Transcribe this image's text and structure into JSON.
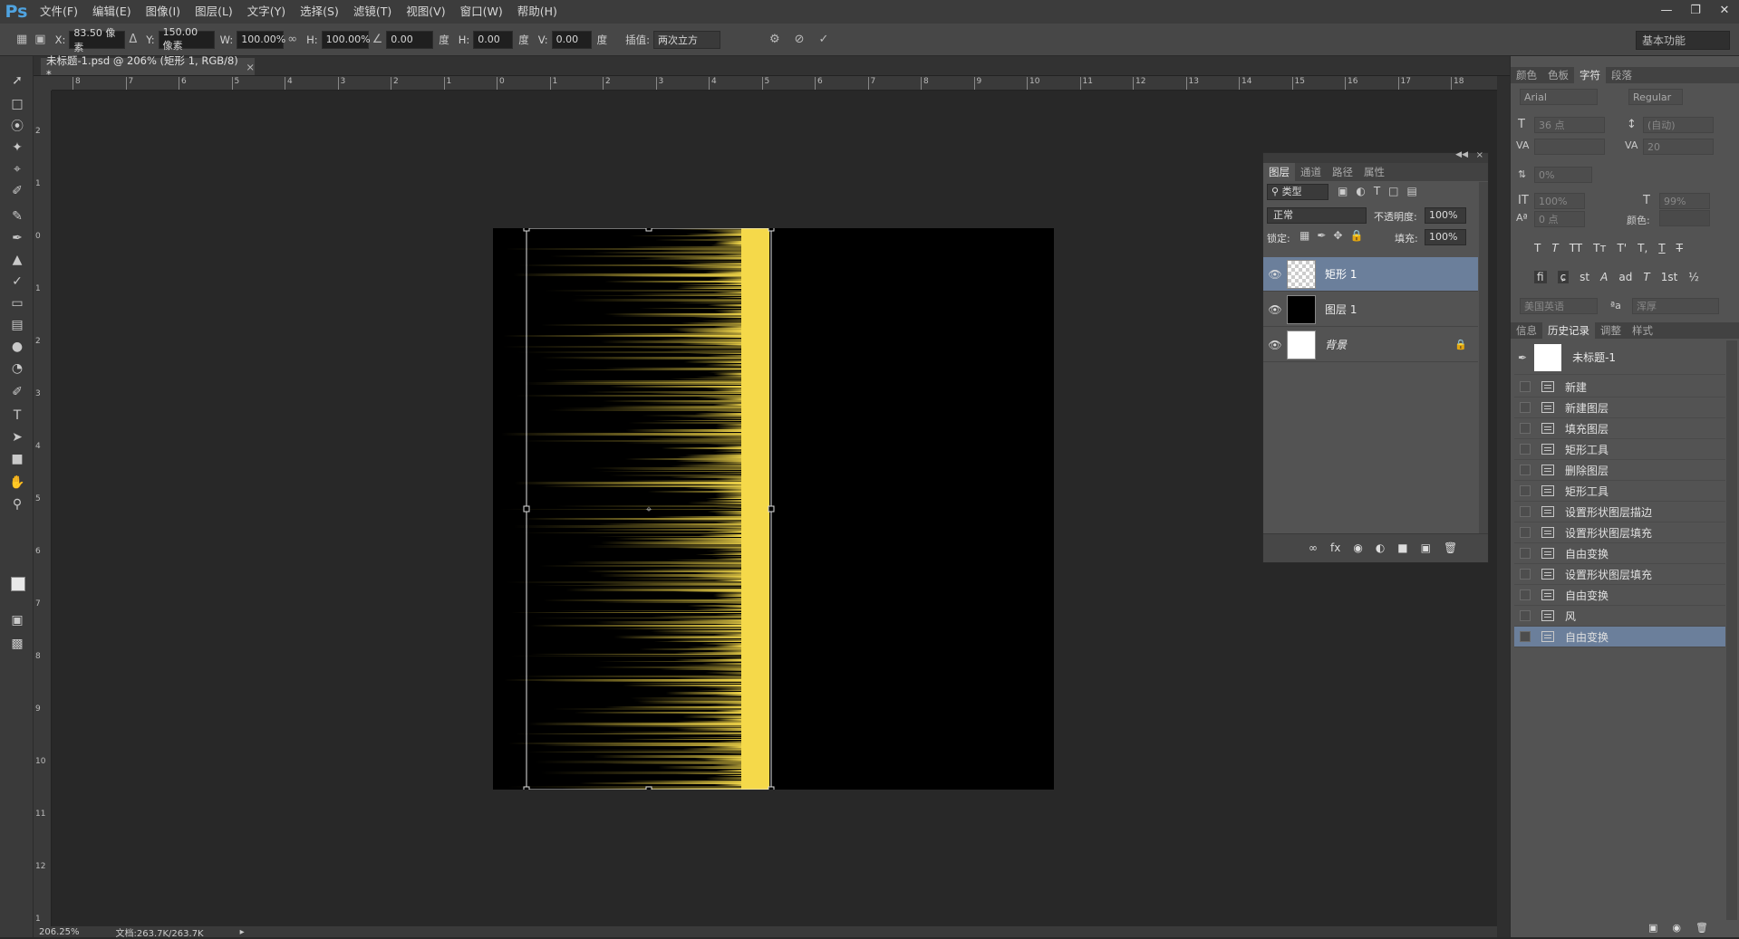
{
  "menubar": {
    "logo": "Ps",
    "items": [
      "文件(F)",
      "编辑(E)",
      "图像(I)",
      "图层(L)",
      "文字(Y)",
      "选择(S)",
      "滤镜(T)",
      "视图(V)",
      "窗口(W)",
      "帮助(H)"
    ]
  },
  "options": {
    "x_label": "X:",
    "x_value": "83.50 像素",
    "y_label": "Y:",
    "y_value": "150.00 像素",
    "w_label": "W:",
    "w_value": "100.00%",
    "h_label": "H:",
    "h_value": "100.00%",
    "angle_value": "0.00",
    "deg": "度",
    "hskew_label": "H:",
    "hskew_value": "0.00",
    "vskew_label": "V:",
    "vskew_value": "0.00",
    "interp_label": "插值:",
    "interp_value": "两次立方",
    "workspace": "基本功能"
  },
  "document": {
    "tab_title": "未标题-1.psd @ 206% (矩形 1, RGB/8) *",
    "zoom": "206.25%",
    "doc_size": "文档:263.7K/263.7K"
  },
  "ruler_top": [
    "8",
    "7",
    "6",
    "5",
    "4",
    "3",
    "2",
    "1",
    "0",
    "1",
    "2",
    "3",
    "4",
    "5",
    "6",
    "7",
    "8",
    "9",
    "10",
    "11",
    "12",
    "13",
    "14",
    "15",
    "16",
    "17",
    "18"
  ],
  "ruler_left": [
    "2",
    "1",
    "0",
    "1",
    "2",
    "3",
    "4",
    "5",
    "6",
    "7",
    "8",
    "9",
    "10",
    "11",
    "12",
    "1"
  ],
  "layers_panel": {
    "tabs": [
      "图层",
      "通道",
      "路径",
      "属性"
    ],
    "filter_label": "类型",
    "blend_mode": "正常",
    "opacity_label": "不透明度:",
    "opacity_value": "100%",
    "lock_label": "锁定:",
    "fill_label": "填充:",
    "fill_value": "100%",
    "layers": [
      {
        "name": "矩形 1",
        "selected": true
      },
      {
        "name": "图层 1",
        "selected": false
      },
      {
        "name": "背景",
        "selected": false
      }
    ]
  },
  "char_panel": {
    "tabs": [
      "颜色",
      "色板",
      "字符",
      "段落"
    ],
    "font_family": "Arial",
    "font_style": "Regular",
    "font_size": "36 点",
    "leading": "(自动)",
    "tracking": "20",
    "scale_pct": "0%",
    "vscale": "100%",
    "hscale": "99%",
    "baseline": "0 点",
    "color_label": "颜色:",
    "style_buttons": [
      "T",
      "T",
      "TT",
      "Tт",
      "T'",
      "T,",
      "T",
      "T"
    ],
    "ot_buttons": [
      "fi",
      "ɕ",
      "st",
      "A",
      "ad",
      "T",
      "1st",
      "½"
    ],
    "language": "美国英语",
    "aa_label": "ªa",
    "aa_value": "浑厚"
  },
  "history_panel": {
    "tabs": [
      "信息",
      "历史记录",
      "调整",
      "样式"
    ],
    "snapshot": "未标题-1",
    "items": [
      "新建",
      "新建图层",
      "填充图层",
      "矩形工具",
      "删除图层",
      "矩形工具",
      "设置形状图层描边",
      "设置形状图层填充",
      "自由变换",
      "设置形状图层填充",
      "自由变换",
      "风",
      "自由变换"
    ]
  },
  "colors": {
    "accent_selection": "#6b7f9b",
    "glow_yellow": "#f5d94a"
  }
}
